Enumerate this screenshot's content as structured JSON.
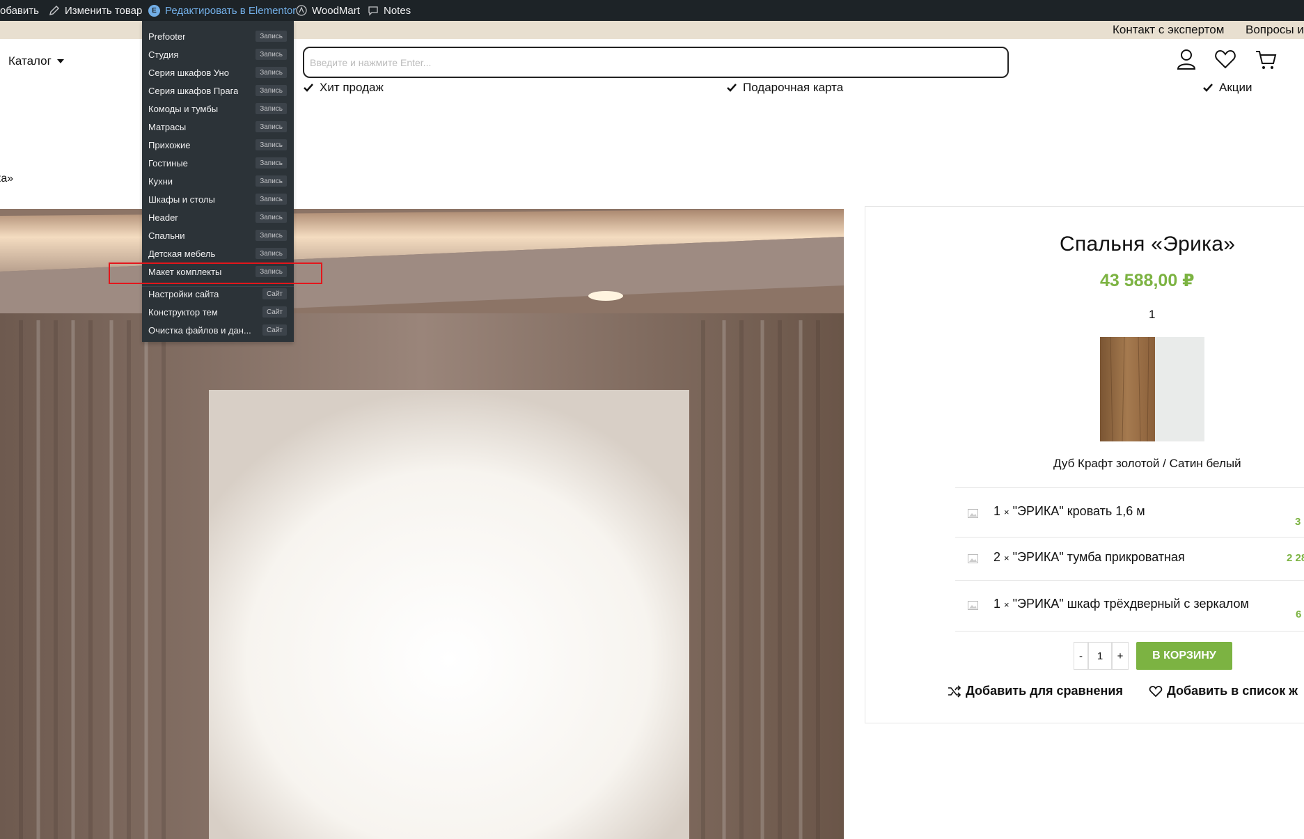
{
  "admin_bar": {
    "add": "обавить",
    "edit_product": "Изменить товар",
    "elementor": "Редактировать в Elementor",
    "woodmart": "WoodMart",
    "notes": "Notes"
  },
  "top_links": [
    "Контакт с экспертом",
    "Вопросы и"
  ],
  "header": {
    "catalog": "Каталог",
    "search_placeholder": "Введите и нажмите Enter...",
    "features": [
      "Хит продаж",
      "Подарочная карта",
      "Акции"
    ]
  },
  "breadcrumb": "ка»",
  "elementor_menu": {
    "items": [
      {
        "label": "Prefooter",
        "badge": "Запись"
      },
      {
        "label": "Студия",
        "badge": "Запись"
      },
      {
        "label": "Серия шкафов Уно",
        "badge": "Запись"
      },
      {
        "label": "Серия шкафов Прага",
        "badge": "Запись"
      },
      {
        "label": "Комоды и тумбы",
        "badge": "Запись"
      },
      {
        "label": "Матрасы",
        "badge": "Запись"
      },
      {
        "label": "Прихожие",
        "badge": "Запись"
      },
      {
        "label": "Гостиные",
        "badge": "Запись"
      },
      {
        "label": "Кухни",
        "badge": "Запись"
      },
      {
        "label": "Шкафы и столы",
        "badge": "Запись"
      },
      {
        "label": "Header",
        "badge": "Запись"
      },
      {
        "label": "Спальни",
        "badge": "Запись"
      },
      {
        "label": "Детская мебель",
        "badge": "Запись"
      },
      {
        "label": "Макет комплекты",
        "badge": "Запись"
      },
      {
        "label": "Настройки сайта",
        "badge": "Сайт"
      },
      {
        "label": "Конструктор тем",
        "badge": "Сайт"
      },
      {
        "label": "Очистка файлов и дан...",
        "badge": "Сайт"
      }
    ]
  },
  "product": {
    "title": "Спальня «Эрика»",
    "price": "43 588,00 ₽",
    "small_number": "1",
    "swatch_label": "Дуб Крафт золотой / Сатин белый",
    "components": [
      {
        "qty": "1",
        "name": "\"ЭРИКА\" кровать 1,6 м",
        "price": "3"
      },
      {
        "qty": "2",
        "name": "\"ЭРИКА\" тумба прикроватная",
        "price": "2 28"
      },
      {
        "qty": "1",
        "name": "\"ЭРИКА\" шкаф трёхдверный с зеркалом",
        "price": "6"
      }
    ],
    "qty_minus": "-",
    "qty_value": "1",
    "qty_plus": "+",
    "add_to_cart": "В КОРЗИНУ",
    "compare": "Добавить для сравнения",
    "wishlist": "Добавить в список ж"
  },
  "colors": {
    "admin_bg": "#1d2327",
    "menu_bg": "#2c3338",
    "accent_green": "#7cb342",
    "topbar_beige": "#e8dfd0",
    "highlight_red": "#e3161b"
  }
}
